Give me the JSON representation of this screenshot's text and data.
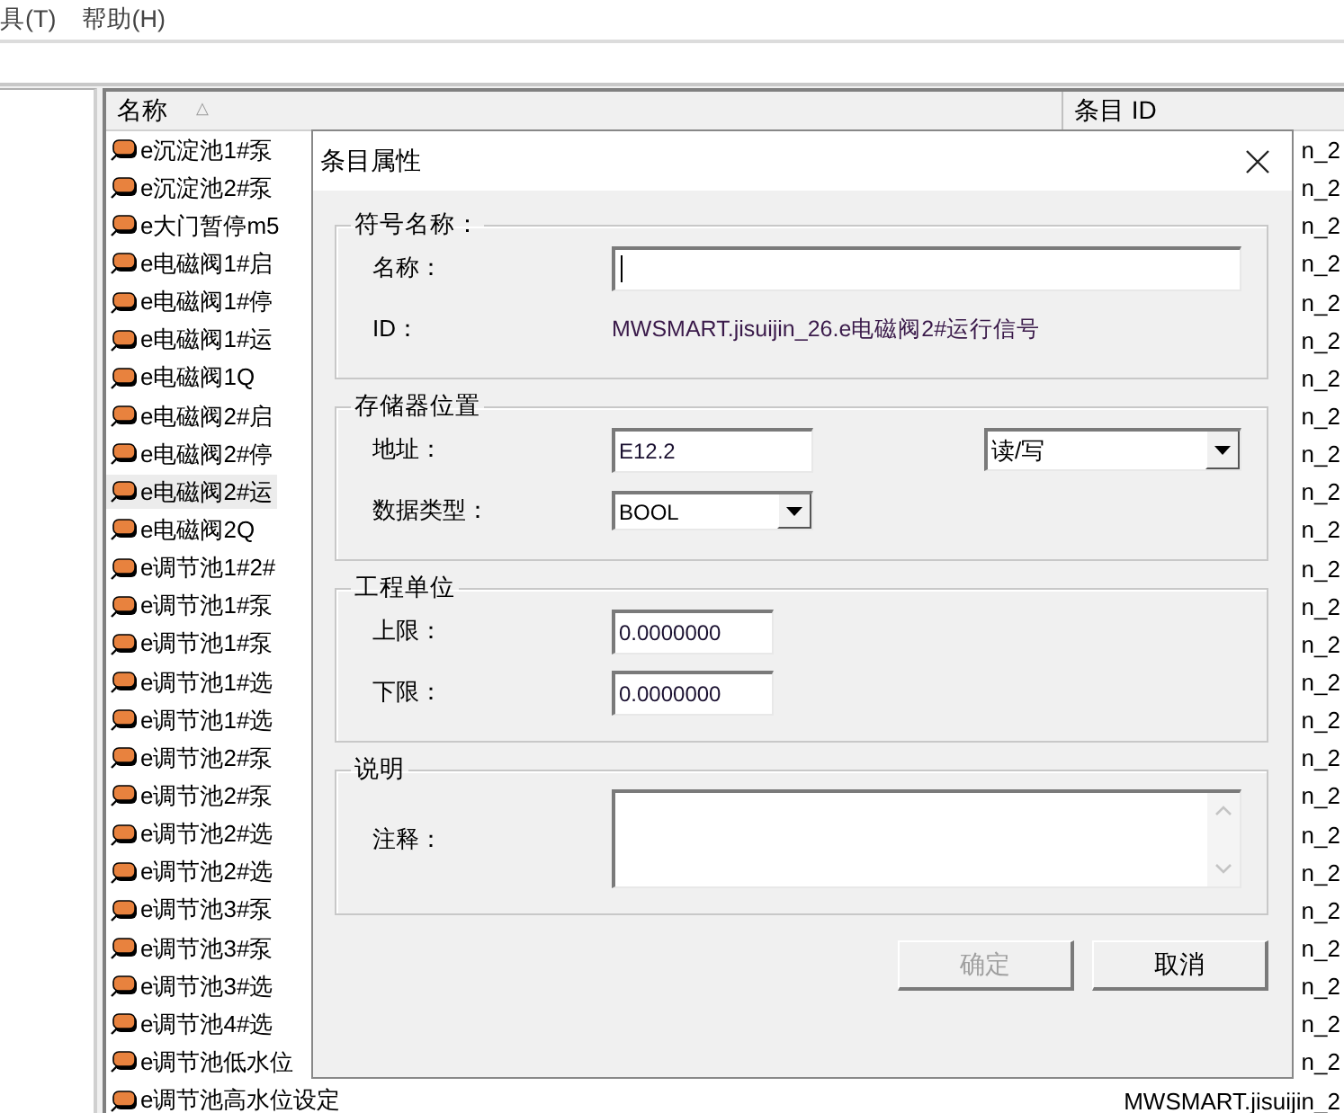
{
  "menu": [
    {
      "label": "具(T)"
    },
    {
      "label": "帮助(H)"
    }
  ],
  "table": {
    "columns": [
      {
        "label": "名称",
        "sort_mark": "△"
      },
      {
        "label": "条目 ID"
      }
    ],
    "rows": [
      {
        "name": "e沉淀池1#泵",
        "id": "n_2",
        "selected": false
      },
      {
        "name": "e沉淀池2#泵",
        "id": "n_2",
        "selected": false
      },
      {
        "name": "e大门暂停m5",
        "id": "n_2",
        "selected": false
      },
      {
        "name": "e电磁阀1#启",
        "id": "n_2",
        "selected": false
      },
      {
        "name": "e电磁阀1#停",
        "id": "n_2",
        "selected": false
      },
      {
        "name": "e电磁阀1#运",
        "id": "n_2",
        "selected": false
      },
      {
        "name": "e电磁阀1Q",
        "id": "n_2",
        "selected": false
      },
      {
        "name": "e电磁阀2#启",
        "id": "n_2",
        "selected": false
      },
      {
        "name": "e电磁阀2#停",
        "id": "n_2",
        "selected": false
      },
      {
        "name": "e电磁阀2#运",
        "id": "n_2",
        "selected": true
      },
      {
        "name": "e电磁阀2Q",
        "id": "n_2",
        "selected": false
      },
      {
        "name": "e调节池1#2#",
        "id": "n_2",
        "selected": false
      },
      {
        "name": "e调节池1#泵",
        "id": "n_2",
        "selected": false
      },
      {
        "name": "e调节池1#泵",
        "id": "n_2",
        "selected": false
      },
      {
        "name": "e调节池1#选",
        "id": "n_2",
        "selected": false
      },
      {
        "name": "e调节池1#选",
        "id": "n_2",
        "selected": false
      },
      {
        "name": "e调节池2#泵",
        "id": "n_2",
        "selected": false
      },
      {
        "name": "e调节池2#泵",
        "id": "n_2",
        "selected": false
      },
      {
        "name": "e调节池2#选",
        "id": "n_2",
        "selected": false
      },
      {
        "name": "e调节池2#选",
        "id": "n_2",
        "selected": false
      },
      {
        "name": "e调节池3#泵",
        "id": "n_2",
        "selected": false
      },
      {
        "name": "e调节池3#泵",
        "id": "n_2",
        "selected": false
      },
      {
        "name": "e调节池3#选",
        "id": "n_2",
        "selected": false
      },
      {
        "name": "e调节池4#选",
        "id": "n_2",
        "selected": false
      },
      {
        "name": "e调节池低水位",
        "id": "n_2",
        "selected": false
      },
      {
        "name": "e调节池高水位设定",
        "id": "MWSMART.jisuijin_2",
        "selected": false
      }
    ]
  },
  "dialog": {
    "title": "条目属性",
    "groups": [
      {
        "title": "符号名称：",
        "fields": [
          {
            "kind": "wide-input",
            "label": "名称：",
            "focused": true
          },
          {
            "kind": "text",
            "label": "ID：",
            "value": "MWSMART.jisuijin_26.e电磁阀2#运行信号"
          }
        ]
      },
      {
        "title": "存储器位置",
        "fields": [
          {
            "kind": "input",
            "label": "地址：",
            "value": "E12.2",
            "side_select": {
              "value": "读/写"
            }
          },
          {
            "kind": "select",
            "label": "数据类型：",
            "value": "BOOL"
          }
        ]
      },
      {
        "title": "工程单位",
        "fields": [
          {
            "kind": "number-input",
            "label": "上限：",
            "value": "0.0000000"
          },
          {
            "kind": "number-input",
            "label": "下限：",
            "value": "0.0000000"
          }
        ]
      },
      {
        "title": "说明",
        "fields": [
          {
            "kind": "textarea",
            "label": "注释："
          }
        ]
      }
    ],
    "buttons": [
      {
        "label": "确定",
        "disabled": true
      },
      {
        "label": "取消",
        "disabled": false
      }
    ]
  }
}
